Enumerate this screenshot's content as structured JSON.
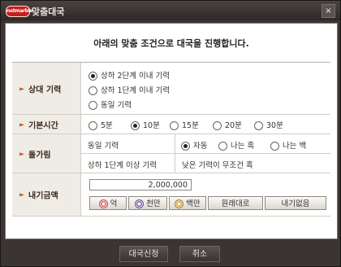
{
  "window": {
    "logo": "netmarble",
    "title": "맞춤대국",
    "close": "×"
  },
  "heading": "아래의 맞춤 조건으로 대국을 진행합니다.",
  "rows": {
    "opponent": {
      "label": "상대 기력",
      "options": [
        "상하 2단계 이내 기력",
        "상하 1단계 이내 기력",
        "동일 기력"
      ],
      "selected": 0
    },
    "basetime": {
      "label": "기본시간",
      "options": [
        "5분",
        "10분",
        "15분",
        "20분",
        "30분"
      ],
      "selected": 1
    },
    "handicap": {
      "label": "돌가림",
      "line1_left": "동일 기력",
      "line1_options": [
        "자동",
        "나는 흑",
        "나는 백"
      ],
      "line1_selected": 0,
      "line2_left": "상하 1단계 이상 기력",
      "line2_right": "낮은 기력이 무조건 흑"
    },
    "bet": {
      "label": "내기금액",
      "amount": "2,000,000",
      "buttons": [
        "억",
        "천만",
        "백만",
        "원래대로",
        "내기없음"
      ]
    }
  },
  "footer": {
    "apply": "대국신청",
    "cancel": "취소"
  }
}
